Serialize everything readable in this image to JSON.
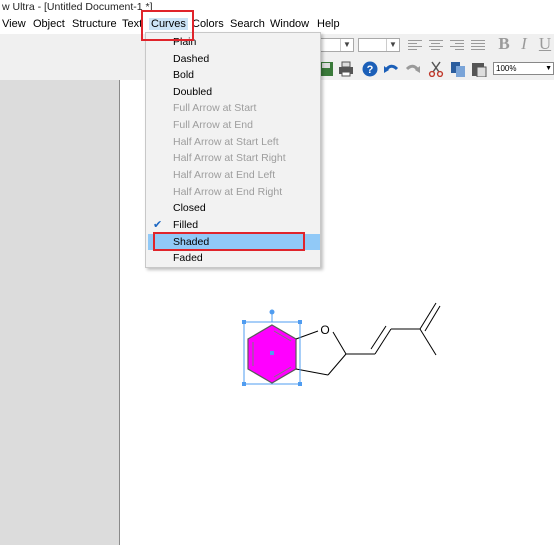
{
  "window": {
    "title": "w Ultra - [Untitled Document-1 *]"
  },
  "menubar": {
    "items": [
      {
        "label": "View"
      },
      {
        "label": "Object"
      },
      {
        "label": "Structure"
      },
      {
        "label": "Text"
      },
      {
        "label": "Curves"
      },
      {
        "label": "Colors"
      },
      {
        "label": "Search"
      },
      {
        "label": "Window"
      },
      {
        "label": "Help"
      }
    ],
    "active": "Curves"
  },
  "toolbar": {
    "zoom_value": "100%",
    "icons": [
      "save-icon",
      "print-icon",
      "help-icon",
      "undo-icon",
      "redo-icon",
      "cut-icon",
      "copy-icon",
      "paste-icon",
      "align-left-icon",
      "align-center-icon",
      "align-right-icon",
      "justify-icon",
      "bold-icon",
      "italic-icon",
      "underline-icon"
    ]
  },
  "curves_menu": {
    "items": [
      {
        "label": "Plain",
        "enabled": true,
        "checked": false
      },
      {
        "label": "Dashed",
        "enabled": true,
        "checked": false
      },
      {
        "label": "Bold",
        "enabled": true,
        "checked": false
      },
      {
        "label": "Doubled",
        "enabled": true,
        "checked": false
      },
      {
        "label": "Full Arrow at Start",
        "enabled": false,
        "checked": false
      },
      {
        "label": "Full Arrow at End",
        "enabled": false,
        "checked": false
      },
      {
        "label": "Half Arrow at Start Left",
        "enabled": false,
        "checked": false
      },
      {
        "label": "Half Arrow at Start Right",
        "enabled": false,
        "checked": false
      },
      {
        "label": "Half Arrow at End Left",
        "enabled": false,
        "checked": false
      },
      {
        "label": "Half Arrow at End Right",
        "enabled": false,
        "checked": false
      },
      {
        "label": "Closed",
        "enabled": true,
        "checked": false
      },
      {
        "label": "Filled",
        "enabled": true,
        "checked": true
      },
      {
        "label": "Shaded",
        "enabled": true,
        "checked": false,
        "highlighted": true
      },
      {
        "label": "Faded",
        "enabled": true,
        "checked": false
      }
    ]
  },
  "molecule": {
    "atom_label": "O",
    "fill_color": "#ff00ff",
    "selection_color": "#4f9cf0"
  },
  "colors": {
    "highlight_box": "#e0242b",
    "menu_highlight": "#91c9f7",
    "left_panel": "#dcdcdc"
  }
}
